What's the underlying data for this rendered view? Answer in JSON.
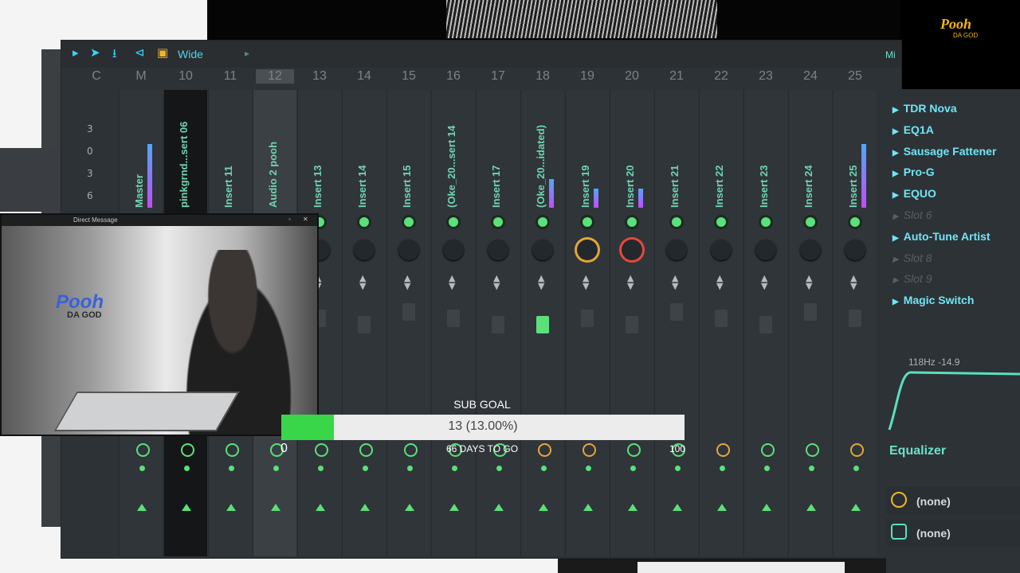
{
  "toolbar": {
    "view_mode": "Wide",
    "right_tab": "Mi"
  },
  "columns": [
    "C",
    "M",
    "10",
    "11",
    "12",
    "13",
    "14",
    "15",
    "16",
    "17",
    "18",
    "19",
    "20",
    "21",
    "22",
    "23",
    "24",
    "25"
  ],
  "levels": [
    "3",
    "0",
    "3",
    "6"
  ],
  "tracks": [
    "Master",
    "pinkgrnd...sert 06",
    "Insert 11",
    "Audio 2 pooh",
    "Insert 13",
    "Insert 14",
    "Insert 15",
    "(Oke_20...sert 14",
    "Insert 17",
    "(Oke_20...idated)",
    "Insert 19",
    "Insert 20",
    "Insert 21",
    "Insert 22",
    "Insert 23",
    "Insert 24",
    "Insert 25"
  ],
  "fx_slots": [
    {
      "name": "TDR Nova",
      "empty": false
    },
    {
      "name": "EQ1A",
      "empty": false
    },
    {
      "name": "Sausage Fattener",
      "empty": false
    },
    {
      "name": "Pro-G",
      "empty": false
    },
    {
      "name": "EQUO",
      "empty": false
    },
    {
      "name": "Slot 6",
      "empty": true
    },
    {
      "name": "Auto-Tune Artist",
      "empty": false
    },
    {
      "name": "Slot 8",
      "empty": true
    },
    {
      "name": "Slot 9",
      "empty": true
    },
    {
      "name": "Magic Switch",
      "empty": false
    }
  ],
  "eq": {
    "readout": "118Hz -14.9",
    "title": "Equalizer"
  },
  "routing": {
    "input": "(none)",
    "output": "(none)"
  },
  "webcam": {
    "window_title": "Direct Message",
    "logo_text": "Pooh",
    "logo_sub": "DA GOD"
  },
  "sub_goal": {
    "title": "SUB GOAL",
    "text": "13 (13.00%)",
    "percent": 13,
    "min": "0",
    "max": "100",
    "days": "66 DAYS TO GO"
  },
  "stream_logo": {
    "text": "Pooh",
    "sub": "DA GOD"
  },
  "colors": {
    "accent": "#5be07a",
    "cyan": "#6fe6f5",
    "orange": "#e3a63a",
    "meter": "#c24cff"
  }
}
